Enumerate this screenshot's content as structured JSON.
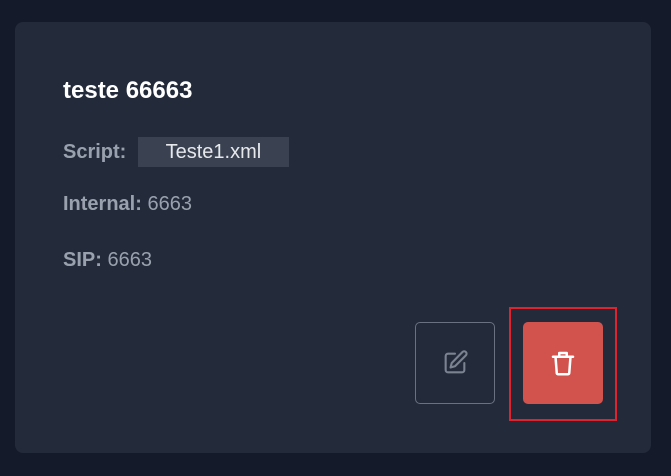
{
  "card": {
    "title": "teste 66663",
    "script": {
      "label": "Script:",
      "value": "Teste1.xml"
    },
    "internal": {
      "label": "Internal:",
      "value": "6663"
    },
    "sip": {
      "label": "SIP:",
      "value": "6663"
    },
    "actions": {
      "edit_icon": "edit-icon",
      "delete_icon": "trash-icon"
    }
  },
  "colors": {
    "page_background": "#151a2a",
    "card_background": "#232a3a",
    "delete_button": "#d2534e",
    "highlight": "#e0222e"
  }
}
